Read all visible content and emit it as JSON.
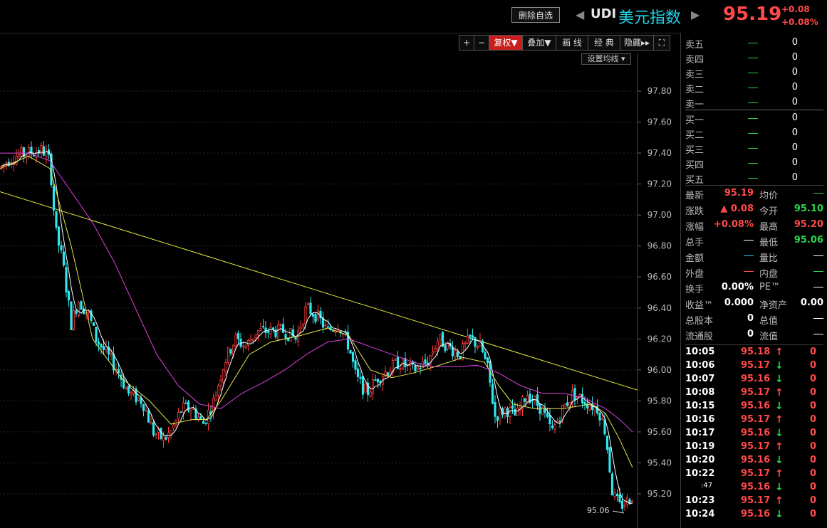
{
  "header": {
    "delete_button": "删除自选",
    "prev_arrow": "◀",
    "next_arrow": "▶",
    "code": "UDI",
    "name": "美元指数",
    "price": "95.19",
    "change": "+0.08",
    "change_pct": "+0.08%"
  },
  "toolbar": {
    "buttons": [
      "+",
      "−",
      "复权▼",
      "叠加▼",
      "画 线",
      "经 典",
      "隐藏▸▸",
      "⛶"
    ],
    "set_ma": "设置均线 ▾"
  },
  "chart_data": {
    "type": "candlestick",
    "ylim": [
      95.06,
      97.9
    ],
    "y_ticks": [
      "97.80",
      "97.60",
      "97.40",
      "97.20",
      "97.00",
      "96.80",
      "96.60",
      "96.40",
      "96.20",
      "96.00",
      "95.80",
      "95.60",
      "95.40",
      "95.20"
    ],
    "low_marker": "95.06",
    "anchors": [
      [
        0,
        97.3
      ],
      [
        10,
        97.35
      ],
      [
        20,
        97.38
      ],
      [
        40,
        97.4
      ],
      [
        60,
        97.42
      ],
      [
        70,
        97.35
      ],
      [
        78,
        96.9
      ],
      [
        88,
        96.7
      ],
      [
        100,
        96.3
      ],
      [
        110,
        96.45
      ],
      [
        125,
        96.35
      ],
      [
        135,
        96.2
      ],
      [
        150,
        96.1
      ],
      [
        165,
        96.0
      ],
      [
        180,
        95.85
      ],
      [
        200,
        95.8
      ],
      [
        215,
        95.6
      ],
      [
        230,
        95.55
      ],
      [
        240,
        95.6
      ],
      [
        255,
        95.75
      ],
      [
        270,
        95.75
      ],
      [
        285,
        95.65
      ],
      [
        300,
        95.8
      ],
      [
        315,
        96.05
      ],
      [
        330,
        96.2
      ],
      [
        345,
        96.15
      ],
      [
        360,
        96.25
      ],
      [
        380,
        96.25
      ],
      [
        400,
        96.25
      ],
      [
        415,
        96.2
      ],
      [
        430,
        96.4
      ],
      [
        445,
        96.35
      ],
      [
        460,
        96.25
      ],
      [
        475,
        96.3
      ],
      [
        490,
        96.15
      ],
      [
        500,
        95.95
      ],
      [
        515,
        95.85
      ],
      [
        530,
        95.95
      ],
      [
        545,
        96.0
      ],
      [
        560,
        96.05
      ],
      [
        580,
        96.0
      ],
      [
        600,
        96.05
      ],
      [
        615,
        96.2
      ],
      [
        630,
        96.15
      ],
      [
        645,
        96.1
      ],
      [
        660,
        96.2
      ],
      [
        675,
        96.15
      ],
      [
        685,
        96.0
      ],
      [
        695,
        95.7
      ],
      [
        710,
        95.75
      ],
      [
        725,
        95.7
      ],
      [
        740,
        95.85
      ],
      [
        760,
        95.75
      ],
      [
        775,
        95.6
      ],
      [
        790,
        95.75
      ],
      [
        805,
        95.85
      ],
      [
        820,
        95.8
      ],
      [
        840,
        95.75
      ],
      [
        850,
        95.6
      ],
      [
        860,
        95.2
      ],
      [
        870,
        95.12
      ],
      [
        880,
        95.15
      ],
      [
        888,
        95.19
      ]
    ],
    "ma_yellow": [
      [
        0,
        97.3
      ],
      [
        40,
        97.38
      ],
      [
        70,
        97.3
      ],
      [
        100,
        96.8
      ],
      [
        130,
        96.2
      ],
      [
        170,
        95.95
      ],
      [
        210,
        95.8
      ],
      [
        240,
        95.65
      ],
      [
        270,
        95.68
      ],
      [
        290,
        95.68
      ],
      [
        310,
        95.8
      ],
      [
        330,
        95.95
      ],
      [
        350,
        96.1
      ],
      [
        380,
        96.18
      ],
      [
        420,
        96.22
      ],
      [
        460,
        96.27
      ],
      [
        490,
        96.22
      ],
      [
        520,
        96.0
      ],
      [
        550,
        95.95
      ],
      [
        580,
        95.98
      ],
      [
        610,
        96.02
      ],
      [
        650,
        96.08
      ],
      [
        680,
        96.05
      ],
      [
        700,
        95.9
      ],
      [
        720,
        95.78
      ],
      [
        750,
        95.75
      ],
      [
        790,
        95.75
      ],
      [
        830,
        95.78
      ],
      [
        850,
        95.72
      ],
      [
        870,
        95.55
      ],
      [
        888,
        95.37
      ]
    ],
    "ma_magenta": [
      [
        0,
        97.4
      ],
      [
        40,
        97.4
      ],
      [
        70,
        97.35
      ],
      [
        100,
        97.15
      ],
      [
        130,
        96.95
      ],
      [
        160,
        96.7
      ],
      [
        190,
        96.4
      ],
      [
        220,
        96.1
      ],
      [
        250,
        95.9
      ],
      [
        280,
        95.78
      ],
      [
        310,
        95.75
      ],
      [
        340,
        95.85
      ],
      [
        370,
        95.92
      ],
      [
        400,
        96.0
      ],
      [
        430,
        96.1
      ],
      [
        460,
        96.18
      ],
      [
        490,
        96.2
      ],
      [
        520,
        96.15
      ],
      [
        550,
        96.1
      ],
      [
        580,
        96.05
      ],
      [
        610,
        96.02
      ],
      [
        640,
        96.02
      ],
      [
        670,
        96.03
      ],
      [
        700,
        95.98
      ],
      [
        730,
        95.9
      ],
      [
        760,
        95.85
      ],
      [
        790,
        95.85
      ],
      [
        820,
        95.82
      ],
      [
        850,
        95.75
      ],
      [
        870,
        95.68
      ],
      [
        888,
        95.6
      ]
    ],
    "trendline": [
      [
        0,
        97.15
      ],
      [
        895,
        95.87
      ]
    ],
    "colors": {
      "up": "#ff3c3c",
      "down": "#2ee6ee",
      "ma1": "#ffffff",
      "ma2": "#e6e650",
      "ma3": "#e040e0",
      "trend": "#e6e640",
      "grid": "#2a2a2a"
    }
  },
  "orderbook": {
    "asks": [
      {
        "label": "卖五",
        "vol": "0"
      },
      {
        "label": "卖四",
        "vol": "0"
      },
      {
        "label": "卖三",
        "vol": "0"
      },
      {
        "label": "卖二",
        "vol": "0"
      },
      {
        "label": "卖一",
        "vol": "0"
      }
    ],
    "bids": [
      {
        "label": "买一",
        "vol": "0"
      },
      {
        "label": "买二",
        "vol": "0"
      },
      {
        "label": "买三",
        "vol": "0"
      },
      {
        "label": "买四",
        "vol": "0"
      },
      {
        "label": "买五",
        "vol": "0"
      }
    ]
  },
  "stats": [
    {
      "l1": "最新",
      "v1": "95.19",
      "c1": "red",
      "l2": "均价",
      "v2": "",
      "c2": "grn"
    },
    {
      "l1": "涨跌",
      "v1": "▲ 0.08",
      "c1": "red",
      "l2": "今开",
      "v2": "95.10",
      "c2": "grn"
    },
    {
      "l1": "涨幅",
      "v1": "+0.08%",
      "c1": "red",
      "l2": "最高",
      "v2": "95.20",
      "c2": "red"
    },
    {
      "l1": "总手",
      "v1": "",
      "c1": "white",
      "l2": "最低",
      "v2": "95.06",
      "c2": "grn"
    },
    {
      "l1": "金额",
      "v1": "",
      "c1": "cyan",
      "l2": "量比",
      "v2": "",
      "c2": "white"
    },
    {
      "l1": "外盘",
      "v1": "",
      "c1": "red",
      "l2": "内盘",
      "v2": "",
      "c2": "grn"
    },
    {
      "l1": "换手",
      "v1": "0.00%",
      "c1": "white",
      "l2": "PE™",
      "v2": "",
      "c2": "white"
    },
    {
      "l1": "收益™",
      "v1": "0.000",
      "c1": "white",
      "l2": "净资产",
      "v2": "0.00",
      "c2": "white"
    },
    {
      "l1": "总股本",
      "v1": "0",
      "c1": "white",
      "l2": "总值",
      "v2": "",
      "c2": "white"
    },
    {
      "l1": "流通股",
      "v1": "0",
      "c1": "white",
      "l2": "流值",
      "v2": "",
      "c2": "white"
    }
  ],
  "ticks": [
    {
      "time": "10:05",
      "price": "95.18",
      "dir": "up",
      "vol": "0"
    },
    {
      "time": "10:06",
      "price": "95.17",
      "dir": "down",
      "vol": "0"
    },
    {
      "time": "10:07",
      "price": "95.16",
      "dir": "down",
      "vol": "0"
    },
    {
      "time": "10:08",
      "price": "95.17",
      "dir": "up",
      "vol": "0"
    },
    {
      "time": "10:15",
      "price": "95.16",
      "dir": "down",
      "vol": "0"
    },
    {
      "time": "10:16",
      "price": "95.17",
      "dir": "up",
      "vol": "0"
    },
    {
      "time": "10:17",
      "price": "95.16",
      "dir": "down",
      "vol": "0"
    },
    {
      "time": "10:19",
      "price": "95.17",
      "dir": "up",
      "vol": "0"
    },
    {
      "time": "10:20",
      "price": "95.16",
      "dir": "down",
      "vol": "0"
    },
    {
      "time": "10:22",
      "price": "95.17",
      "dir": "up",
      "vol": "0"
    },
    {
      "time": ":47",
      "price": "95.16",
      "dir": "down",
      "vol": "0"
    },
    {
      "time": "10:23",
      "price": "95.17",
      "dir": "up",
      "vol": "0"
    },
    {
      "time": "10:24",
      "price": "95.16",
      "dir": "down",
      "vol": "0"
    }
  ]
}
